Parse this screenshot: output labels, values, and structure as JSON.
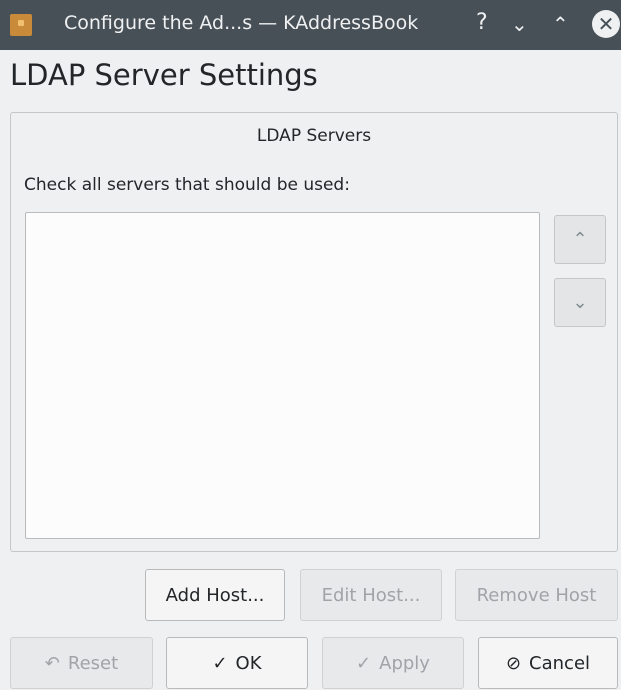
{
  "window": {
    "title": "Configure the Ad...s — KAddressBook",
    "help_icon": "?",
    "minimize_icon": "⌄",
    "maximize_icon": "⌃",
    "close_icon": "✕"
  },
  "page": {
    "title": "LDAP Server Settings"
  },
  "group": {
    "title": "LDAP Servers",
    "check_label": "Check all servers that should be used:",
    "servers": []
  },
  "arrows": {
    "up_icon": "⌃",
    "down_icon": "⌄"
  },
  "host_buttons": {
    "add": "Add Host...",
    "edit": "Edit Host...",
    "remove": "Remove Host"
  },
  "dialog_buttons": {
    "reset": "Reset",
    "ok": "OK",
    "apply": "Apply",
    "cancel": "Cancel",
    "reset_icon": "↶",
    "ok_icon": "✓",
    "apply_icon": "✓",
    "cancel_icon": "⊘"
  },
  "colors": {
    "titlebar": "#475057",
    "background": "#eff0f1",
    "text": "#232629",
    "disabled_text": "#a0a4a8"
  }
}
